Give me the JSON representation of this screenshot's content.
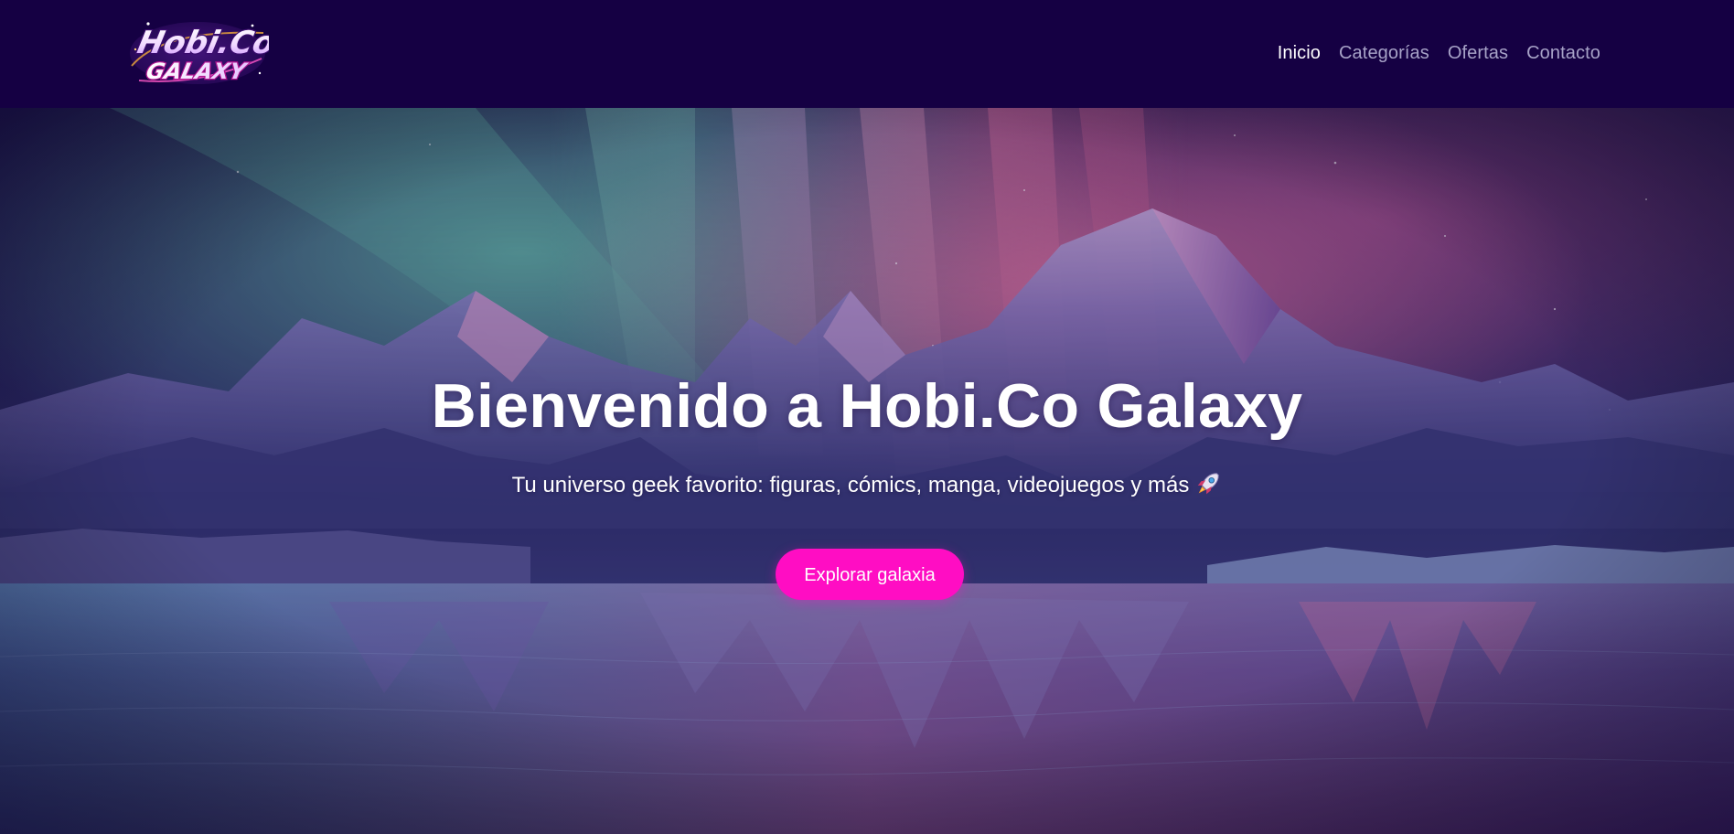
{
  "brand": {
    "logo_line1": "Hobi.Co",
    "logo_line2": "GALAXY"
  },
  "nav": {
    "items": [
      {
        "label": "Inicio",
        "active": true
      },
      {
        "label": "Categorías",
        "active": false
      },
      {
        "label": "Ofertas",
        "active": false
      },
      {
        "label": "Contacto",
        "active": false
      }
    ]
  },
  "hero": {
    "title": "Bienvenido a Hobi.Co Galaxy",
    "subtitle": "Tu universo geek favorito: figuras, cómics, manga, videojuegos y más",
    "subtitle_icon": "rocket-icon",
    "cta_label": "Explorar galaxia"
  },
  "colors": {
    "navbar_bg": "#150043",
    "nav_active": "#ffffff",
    "nav_inactive": "#a7a2c7",
    "cta_bg": "#ff0dc3",
    "hero_text": "#ffffff"
  }
}
